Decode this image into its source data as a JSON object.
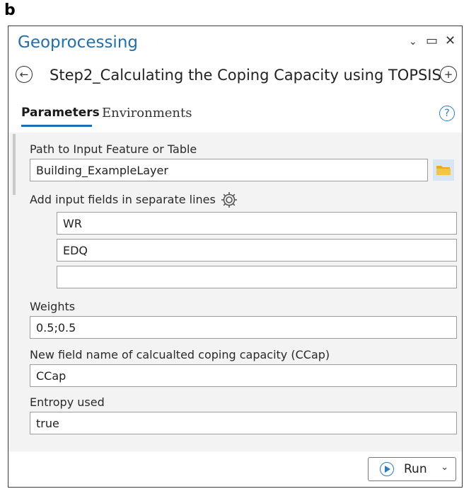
{
  "figure_label": "b",
  "window": {
    "title": "Geoprocessing",
    "controls": {
      "options": "⌄",
      "maximize": "▭",
      "close": "✕"
    }
  },
  "tool": {
    "back_icon": "back-arrow-icon",
    "title": "Step2_Calculating the Coping Capacity using TOPSIS",
    "add_icon": "add-icon"
  },
  "tabs": [
    {
      "label": "Parameters",
      "active": true
    },
    {
      "label": "Environments",
      "active": false
    }
  ],
  "help_icon": "?",
  "params": {
    "input_path": {
      "label": "Path to Input Feature or Table",
      "value": "Building_ExampleLayer"
    },
    "input_fields": {
      "label": "Add input fields in separate lines",
      "values": [
        "WR",
        "EDQ",
        ""
      ]
    },
    "weights": {
      "label": "Weights",
      "value": "0.5;0.5"
    },
    "new_field": {
      "label": "New field name of calcualted coping capacity (CCap)",
      "value": "CCap"
    },
    "entropy": {
      "label": "Entropy used",
      "value": "true"
    }
  },
  "run": {
    "label": "Run",
    "chevron": "⌄"
  },
  "colors": {
    "accent": "#1f6fb2",
    "folder": "#f1b52c",
    "panel_bg": "#f3f3f3"
  }
}
